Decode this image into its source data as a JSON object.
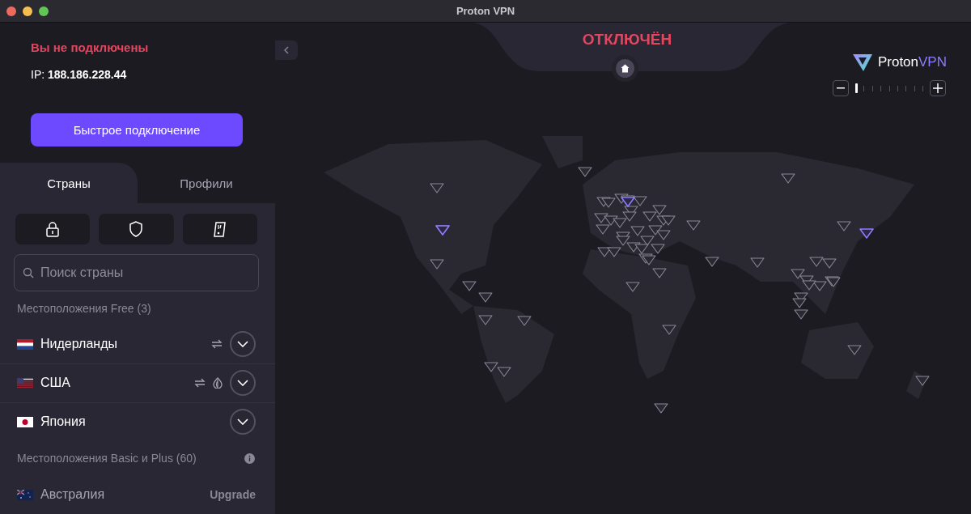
{
  "window": {
    "title": "Proton VPN"
  },
  "status": {
    "headline": "Вы не подключены",
    "ip_label": "IP:",
    "ip": "188.186.228.44",
    "connected": false
  },
  "quick_connect": {
    "label": "Быстрое подключение"
  },
  "tabs": [
    {
      "label": "Страны",
      "selected": true
    },
    {
      "label": "Профили",
      "selected": false
    }
  ],
  "filters": [
    {
      "kind": "lock",
      "selected": false
    },
    {
      "kind": "shield",
      "selected": false
    },
    {
      "kind": "card",
      "selected": false
    }
  ],
  "search": {
    "placeholder": "Поиск страны"
  },
  "sections": [
    {
      "title": "Местоположения Free (3)",
      "info": false,
      "countries": [
        {
          "name": "Нидерланды",
          "kind": "nl",
          "p2p": true,
          "tor": false,
          "locked": false
        },
        {
          "name": "США",
          "kind": "us",
          "p2p": true,
          "tor": true,
          "locked": false
        },
        {
          "name": "Япония",
          "kind": "jp",
          "p2p": false,
          "tor": false,
          "locked": false
        }
      ]
    },
    {
      "title": "Местоположения Basic и Plus (60)",
      "info": true,
      "countries": [
        {
          "name": "Австралия",
          "kind": "au",
          "p2p": false,
          "tor": false,
          "locked": true,
          "action": "Upgrade"
        }
      ]
    }
  ],
  "map": {
    "state": "ОТКЛЮЧЁН",
    "brand_first": "Proton",
    "brand_second": "VPN",
    "zoom": {
      "level": 0
    }
  }
}
